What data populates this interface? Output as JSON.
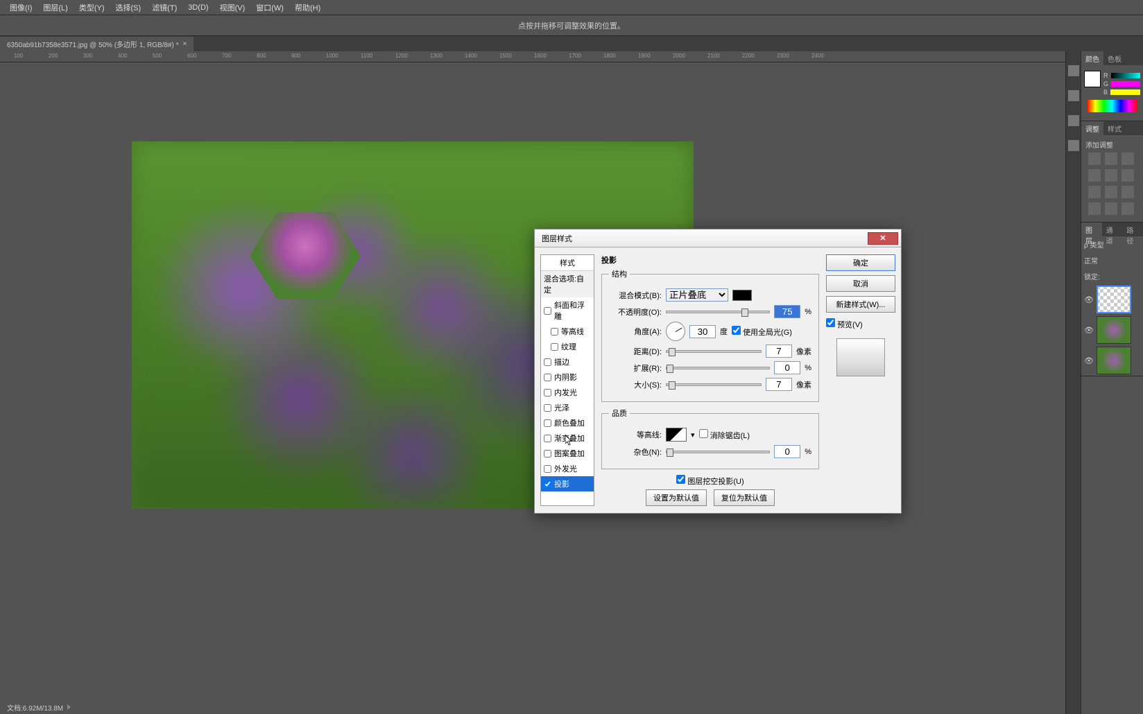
{
  "menu": [
    "图像(I)",
    "图层(L)",
    "类型(Y)",
    "选择(S)",
    "滤镜(T)",
    "3D(D)",
    "视图(V)",
    "窗口(W)",
    "帮助(H)"
  ],
  "options_hint": "点按并拖移可调整效果的位置。",
  "doc_tab": "6350ab91b7358e3571.jpg @ 50% (多边形 1, RGB/8#) *",
  "ruler_ticks": [
    "100",
    "200",
    "300",
    "400",
    "500",
    "600",
    "700",
    "800",
    "900",
    "1000",
    "1100",
    "1200",
    "1300",
    "1400",
    "1500",
    "1600",
    "1700",
    "1800",
    "1900",
    "2000",
    "2100",
    "2200",
    "2300",
    "2400"
  ],
  "panels": {
    "color_tab": "颜色",
    "swatches_tab": "色板",
    "rgb": {
      "r": "R",
      "g": "G",
      "b": "B"
    },
    "adjust_tab": "调整",
    "styles_tab": "样式",
    "add_adjust": "添加调整",
    "layers_tab": "图层",
    "channels_tab": "通道",
    "paths_tab": "路径",
    "kind": "ρ 类型",
    "normal": "正常",
    "lock": "锁定:"
  },
  "dialog": {
    "title": "图层样式",
    "styles_header": "样式",
    "blend_options": "混合选项:自定",
    "items": [
      {
        "label": "斜面和浮雕",
        "checked": false,
        "indent": false
      },
      {
        "label": "等高线",
        "checked": false,
        "indent": true
      },
      {
        "label": "纹理",
        "checked": false,
        "indent": true
      },
      {
        "label": "描边",
        "checked": false,
        "indent": false
      },
      {
        "label": "内阴影",
        "checked": false,
        "indent": false
      },
      {
        "label": "内发光",
        "checked": false,
        "indent": false
      },
      {
        "label": "光泽",
        "checked": false,
        "indent": false
      },
      {
        "label": "颜色叠加",
        "checked": false,
        "indent": false
      },
      {
        "label": "渐变叠加",
        "checked": false,
        "indent": false
      },
      {
        "label": "图案叠加",
        "checked": false,
        "indent": false
      },
      {
        "label": "外发光",
        "checked": false,
        "indent": false
      },
      {
        "label": "投影",
        "checked": true,
        "indent": false,
        "selected": true
      }
    ],
    "section_title": "投影",
    "structure_legend": "结构",
    "blend_mode_label": "混合模式(B):",
    "blend_mode_value": "正片叠底",
    "opacity_label": "不透明度(O):",
    "opacity_value": "75",
    "percent": "%",
    "angle_label": "角度(A):",
    "angle_value": "30",
    "degree": "度",
    "global_light": "使用全局光(G)",
    "distance_label": "距离(D):",
    "distance_value": "7",
    "pixels": "像素",
    "spread_label": "扩展(R):",
    "spread_value": "0",
    "size_label": "大小(S):",
    "size_value": "7",
    "quality_legend": "品质",
    "contour_label": "等高线:",
    "antialias": "消除锯齿(L)",
    "noise_label": "杂色(N):",
    "noise_value": "0",
    "knockout": "图层挖空投影(U)",
    "make_default": "设置为默认值",
    "reset_default": "复位为默认值",
    "ok": "确定",
    "cancel": "取消",
    "new_style": "新建样式(W)...",
    "preview": "预览(V)"
  },
  "status": "文档:6.92M/13.8M"
}
